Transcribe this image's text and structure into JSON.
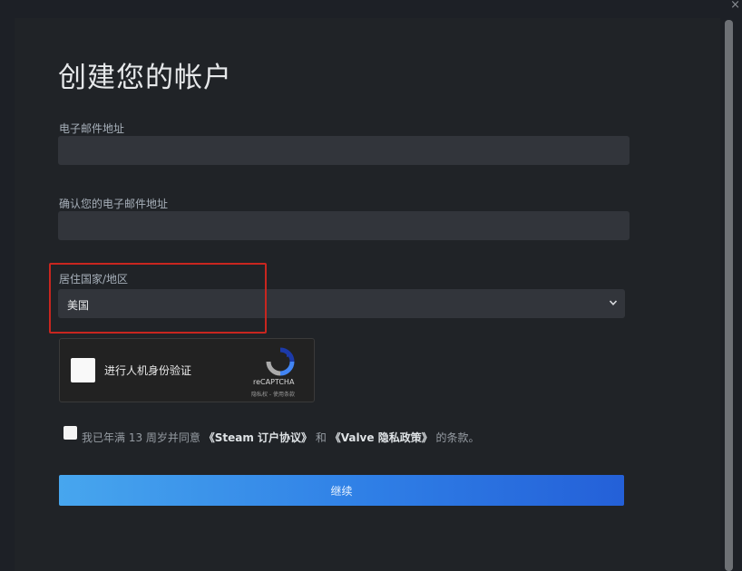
{
  "form": {
    "title": "创建您的帐户",
    "email_label": "电子邮件地址",
    "email_value": "",
    "confirm_email_label": "确认您的电子邮件地址",
    "confirm_email_value": "",
    "country_label": "居住国家/地区",
    "country_selected": "美国",
    "captcha": {
      "label": "进行人机身份验证",
      "brand": "reCAPTCHA",
      "links": "隐私权 - 使用条款"
    },
    "agreement": {
      "prefix": "我已年满 13 周岁并同意",
      "steam_agreement": "《Steam 订户协议》",
      "middle": "和",
      "valve_policy": "《Valve 隐私政策》",
      "suffix": "的条款。",
      "checked": false
    },
    "continue_label": "继续"
  },
  "colors": {
    "background": "#1d2026",
    "highlight_border": "#c8261f",
    "button_start": "#47a6ee",
    "button_end": "#2460d8"
  }
}
